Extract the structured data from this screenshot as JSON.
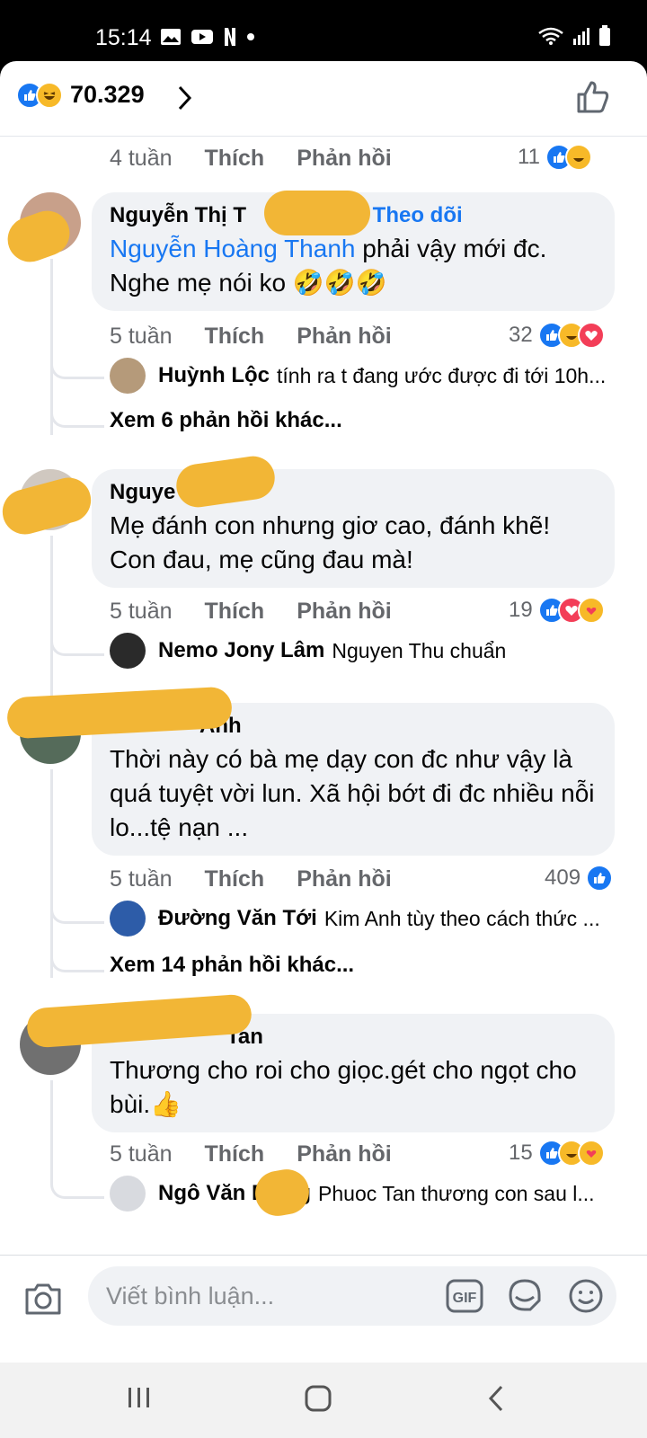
{
  "status_bar": {
    "time": "15:14"
  },
  "header": {
    "reaction_total": "70.329"
  },
  "comments": [
    {
      "time": "4 tuần",
      "like": "Thích",
      "reply": "Phản hồi",
      "react_count": "11",
      "reactions": [
        "like-icon",
        "haha-icon"
      ]
    },
    {
      "name": "Nguyễn Thị T",
      "follow": "· Theo dõi",
      "tag": "Nguyễn Hoàng Thanh",
      "text_after_tag": " phải vậy mới đc.",
      "text_line2": "Nghe mẹ nói ko 🤣🤣🤣",
      "time": "5 tuần",
      "like": "Thích",
      "reply": "Phản hồi",
      "react_count": "32",
      "reactions": [
        "like-icon",
        "haha-icon",
        "love-icon"
      ],
      "reply_preview": {
        "name": "Huỳnh Lộc",
        "text": "tính ra t đang ước được đi tới 10h..."
      },
      "more": "Xem 6 phản hồi khác..."
    },
    {
      "name": "Nguye",
      "text": "Mẹ đánh con nhưng giơ cao, đánh khẽ! Con đau, mẹ cũng đau mà!",
      "time": "5 tuần",
      "like": "Thích",
      "reply": "Phản hồi",
      "react_count": "19",
      "reactions": [
        "like-icon",
        "love-icon",
        "care-icon"
      ],
      "reply_preview": {
        "name": "Nemo Jony Lâm",
        "text": "Nguyen Thu chuẩn"
      }
    },
    {
      "name": "Anh",
      "text": "Thời này có bà mẹ dạy con đc như vậy là quá tuyệt vời lun. Xã hội bớt đi đc nhiều nỗi lo...tệ nạn ...",
      "time": "5 tuần",
      "like": "Thích",
      "reply": "Phản hồi",
      "react_count": "409",
      "reactions": [
        "like-icon"
      ],
      "reply_preview": {
        "name": "Đường Văn Tới",
        "text": "Kim Anh tùy theo cách thức ..."
      },
      "more": "Xem 14 phản hồi khác..."
    },
    {
      "name": "Tan",
      "text": "Thương cho roi cho giọc.gét cho ngọt cho bùi.👍",
      "time": "5 tuần",
      "like": "Thích",
      "reply": "Phản hồi",
      "react_count": "15",
      "reactions": [
        "like-icon",
        "haha-icon",
        "care-icon"
      ],
      "reply_preview": {
        "name": "Ngô Văn B",
        "name_suffix": "g",
        "text": "Phuoc Tan thương con sau l..."
      }
    }
  ],
  "composer": {
    "placeholder": "Viết bình luận...",
    "gif": "GIF"
  }
}
